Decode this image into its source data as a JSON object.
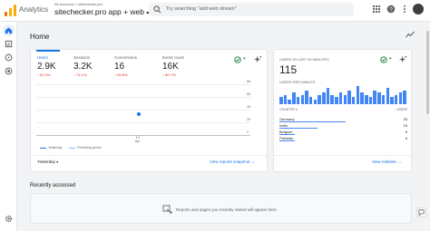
{
  "app": {
    "name": "Analytics",
    "account_crumb": "All accounts > sitechecker.pro",
    "property_name": "sitechecker.pro app + web",
    "search_placeholder": "Try searching \"add web stream\""
  },
  "home": {
    "title": "Home"
  },
  "overview": {
    "metrics": [
      {
        "label": "Users",
        "value": "2.9K",
        "change": "↓ 51.3%"
      },
      {
        "label": "Sessions",
        "value": "3.2K",
        "change": "↓ 74.1%"
      },
      {
        "label": "Conversions",
        "value": "16",
        "change": "↓ 99.6%"
      },
      {
        "label": "Event count",
        "value": "16K",
        "change": "↓ 80.7%"
      }
    ],
    "y_ticks": [
      "6K",
      "4K",
      "2K",
      "0"
    ],
    "x_tick_day": "13",
    "x_tick_month": "Apr",
    "legend_current": "Yesterday",
    "legend_previous": "Preceding period",
    "date_range": "Yesterday",
    "link": "View reports snapshot"
  },
  "realtime": {
    "title": "USERS IN LAST 30 MINUTES",
    "value": "115",
    "per_minute_label": "USERS PER MINUTE",
    "col_country": "COUNTRY",
    "col_users": "USERS",
    "rows": [
      {
        "country": "Germany",
        "users": "25",
        "share": 0.52
      },
      {
        "country": "India",
        "users": "15",
        "share": 0.3
      },
      {
        "country": "Belgium",
        "users": "6",
        "share": 0.12
      },
      {
        "country": "Pakistan",
        "users": "6",
        "share": 0.12
      }
    ],
    "per_minute": [
      3,
      4,
      2,
      5,
      3,
      4,
      6,
      3,
      2,
      4,
      5,
      7,
      4,
      3,
      5,
      4,
      6,
      3,
      8,
      5,
      4,
      3,
      6,
      5,
      4,
      7,
      3,
      4,
      5,
      6
    ],
    "link": "View realtime"
  },
  "recent": {
    "title": "Recently accessed",
    "empty_text": "Reports and pages you recently visited will appear here."
  },
  "colors": {
    "accent": "#1a73e8",
    "bar": "#4285f4",
    "negative": "#d93025",
    "logo_orange": "#f9ab00",
    "logo_dark_orange": "#e37400"
  }
}
